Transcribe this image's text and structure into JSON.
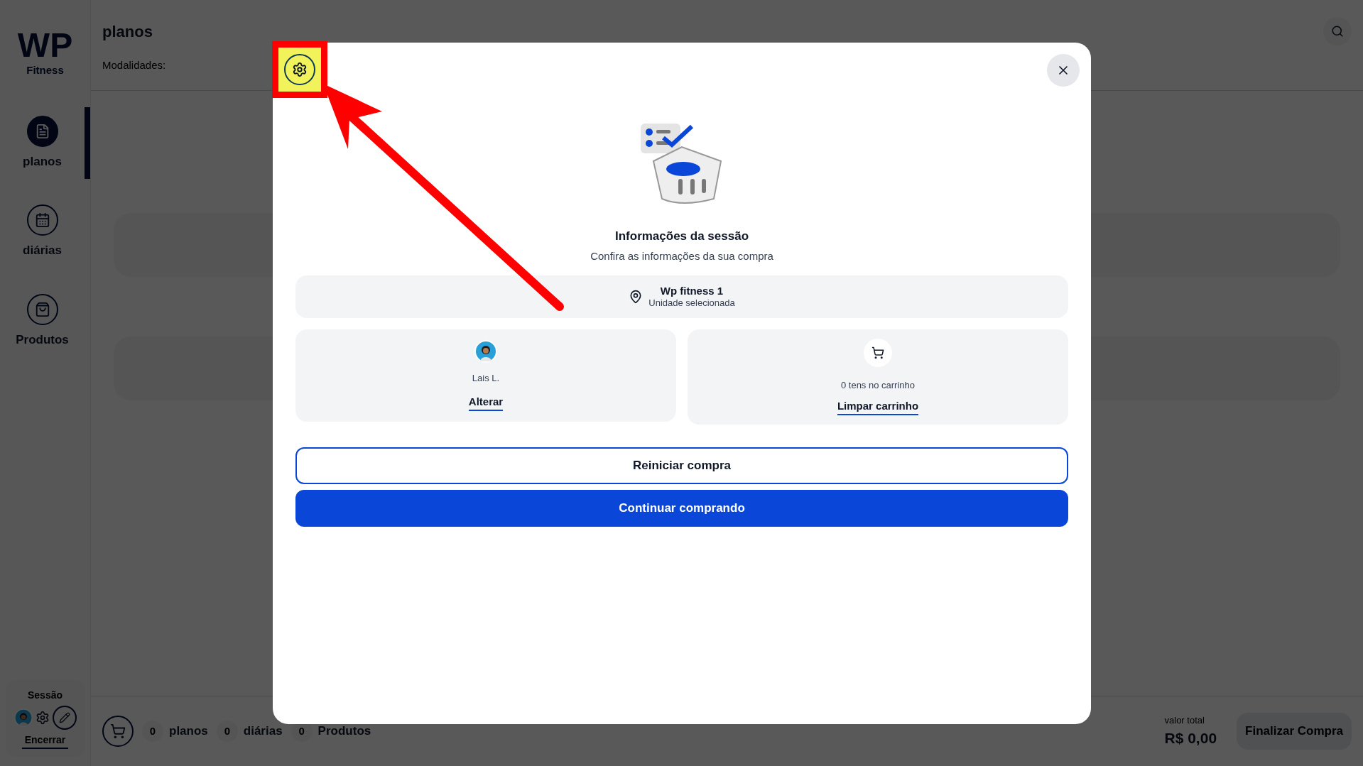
{
  "logo": {
    "mark": "WP",
    "subtitle": "Fitness"
  },
  "sidebar": {
    "items": [
      {
        "label": "planos",
        "selected": true
      },
      {
        "label": "diárias",
        "selected": false
      },
      {
        "label": "Produtos",
        "selected": false
      }
    ],
    "session": {
      "title": "Sessão",
      "end_link": "Encerrar"
    }
  },
  "header": {
    "title": "planos",
    "filter_label": "Modalidades:"
  },
  "footer": {
    "counts": [
      {
        "count": "0",
        "label": "planos"
      },
      {
        "count": "0",
        "label": "diárias"
      },
      {
        "count": "0",
        "label": "Produtos"
      }
    ],
    "total_label": "valor total",
    "total_value": "R$ 0,00",
    "checkout_button": "Finalizar Compra"
  },
  "modal": {
    "title": "Informações da sessão",
    "subtitle": "Confira as informações da sua compra",
    "unit": {
      "name": "Wp fitness 1",
      "caption": "Unidade selecionada"
    },
    "customer": {
      "name": "Lais L.",
      "action": "Alterar"
    },
    "cart": {
      "summary": "0 tens no carrinho",
      "action": "Limpar carrinho"
    },
    "buttons": [
      {
        "label": "Reiniciar compra",
        "kind": "outline"
      },
      {
        "label": "Continuar comprando",
        "kind": "primary"
      }
    ]
  }
}
